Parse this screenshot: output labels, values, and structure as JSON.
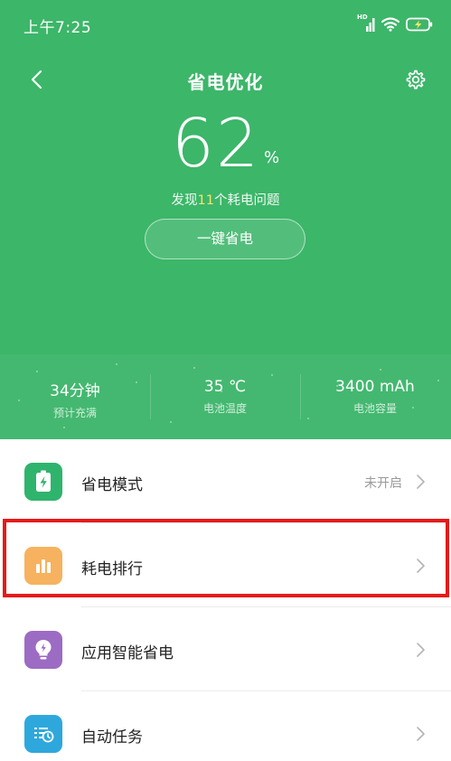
{
  "status_bar": {
    "time": "上午7:25",
    "network_label": "HD"
  },
  "header": {
    "title": "省电优化"
  },
  "battery": {
    "percent": "62",
    "unit": "%",
    "issues_prefix": "发现",
    "issues_count": "11",
    "issues_suffix": "个耗电问题",
    "button_label": "一键省电"
  },
  "stats": [
    {
      "value": "34分钟",
      "label": "预计充满"
    },
    {
      "value": "35 ℃",
      "label": "电池温度"
    },
    {
      "value": "3400 mAh",
      "label": "电池容量"
    }
  ],
  "menu": [
    {
      "label": "省电模式",
      "value": "未开启",
      "icon": "battery-bolt-icon",
      "color": "#2fb46d"
    },
    {
      "label": "耗电排行",
      "value": "",
      "icon": "bar-chart-icon",
      "color": "#f7b25f"
    },
    {
      "label": "应用智能省电",
      "value": "",
      "icon": "lightbulb-icon",
      "color": "#9c6bc3"
    },
    {
      "label": "自动任务",
      "value": "",
      "icon": "task-clock-icon",
      "color": "#2ea8dc"
    }
  ],
  "colors": {
    "primary": "#3cb669",
    "highlight": "#e61a1a"
  }
}
